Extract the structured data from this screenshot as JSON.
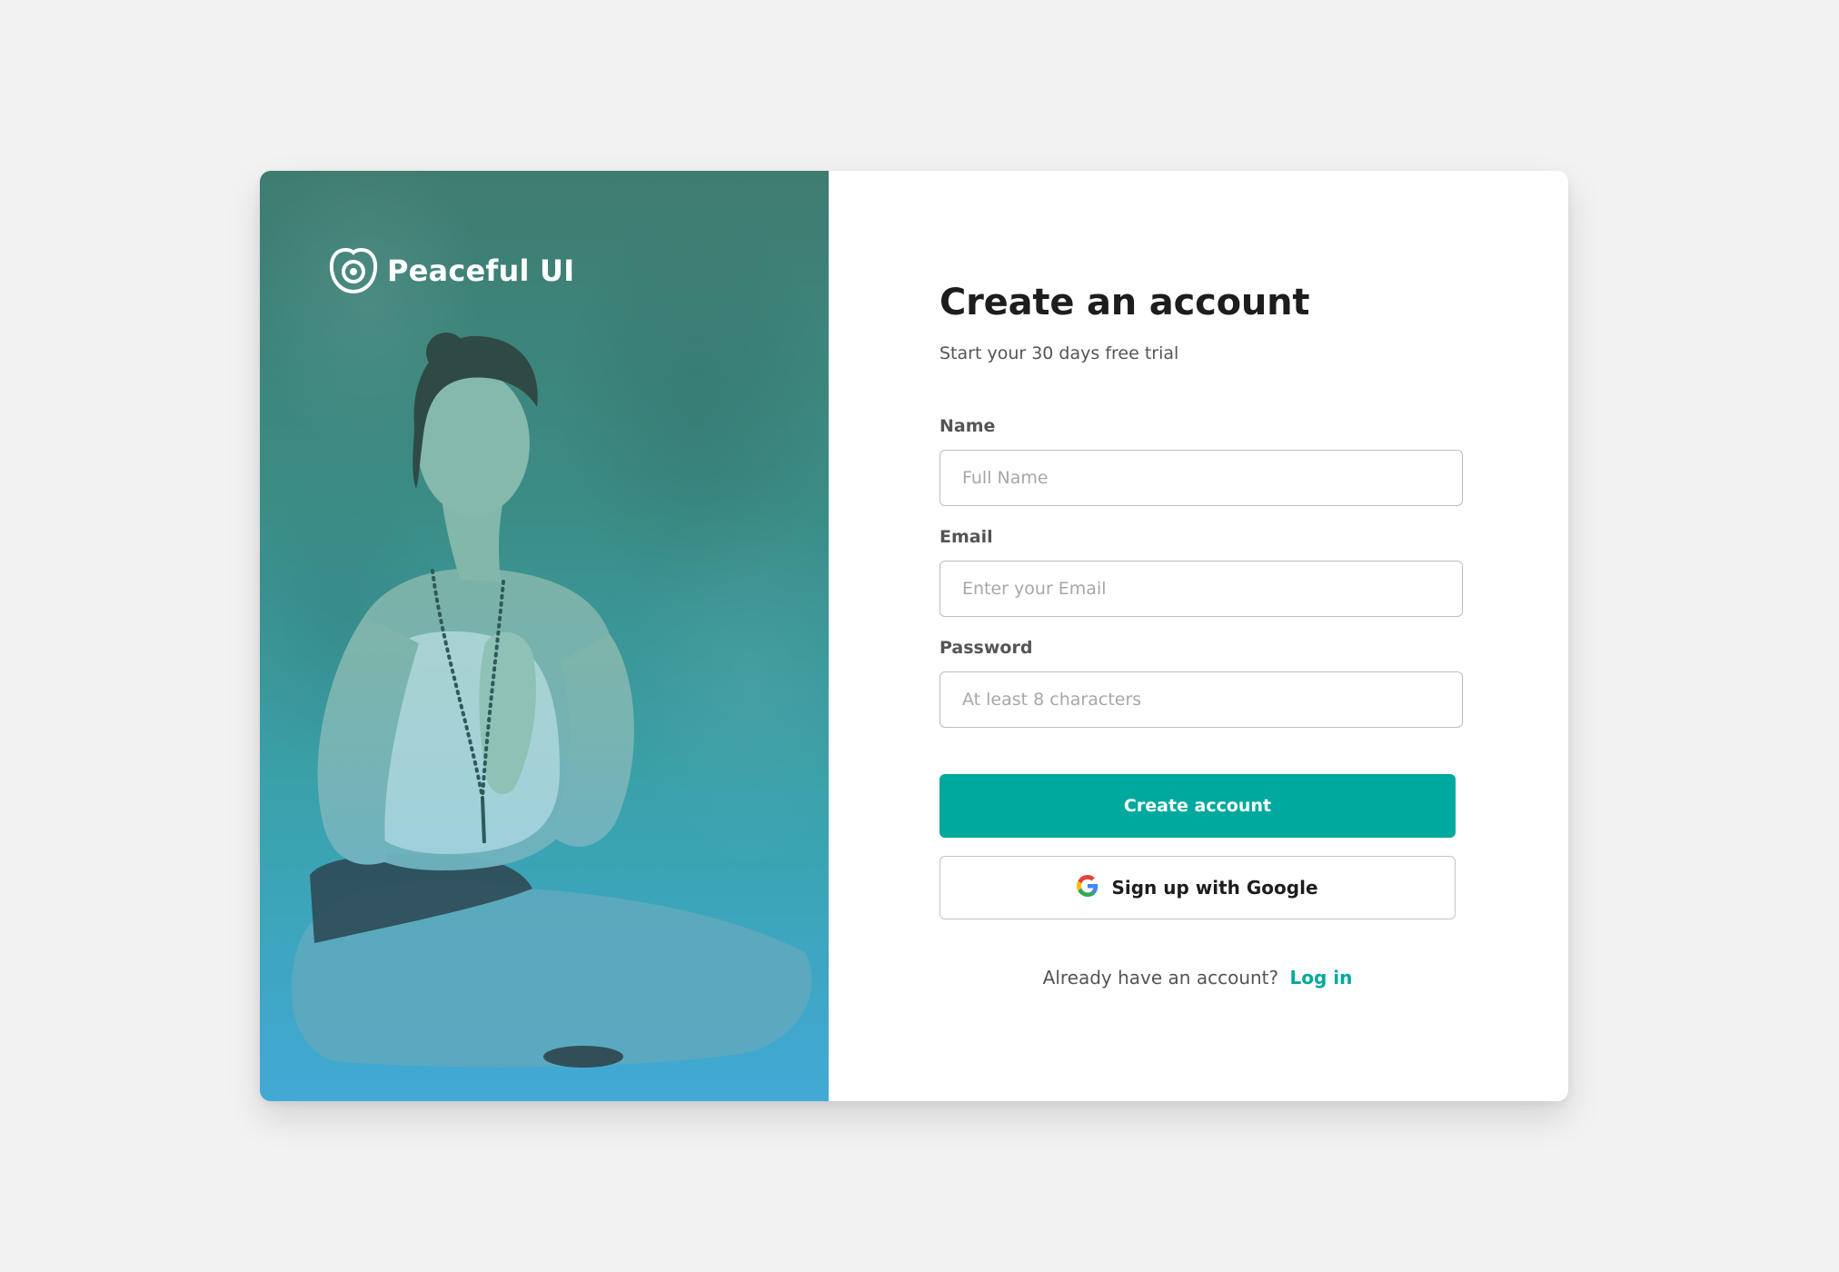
{
  "brand": {
    "name": "Peaceful UI",
    "icon": "peaceful-logo-icon"
  },
  "form": {
    "title": "Create an account",
    "subtitle": "Start your 30 days free trial",
    "fields": {
      "name": {
        "label": "Name",
        "placeholder": "Full Name",
        "value": ""
      },
      "email": {
        "label": "Email",
        "placeholder": "Enter your Email",
        "value": ""
      },
      "password": {
        "label": "Password",
        "placeholder": "At least 8 characters",
        "value": ""
      }
    },
    "primary_button": "Create account",
    "google_button": "Sign up with Google",
    "login_prompt": "Already have an account?",
    "login_link": "Log in"
  },
  "colors": {
    "accent": "#00a99d",
    "page_background": "#f2f2f2",
    "card_background": "#ffffff",
    "panel_gradient_top": "#3f7c70",
    "panel_gradient_bottom": "#42a9d6"
  }
}
